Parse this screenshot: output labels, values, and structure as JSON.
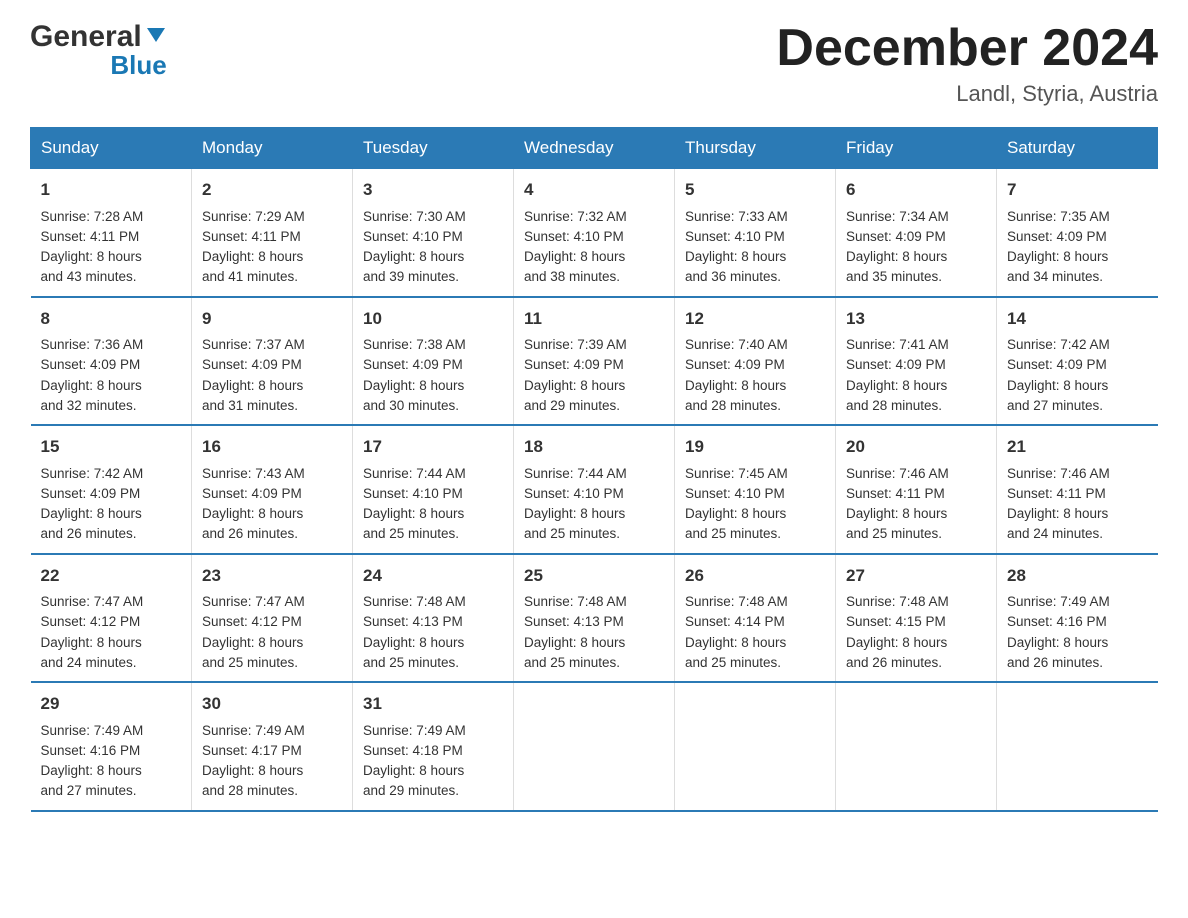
{
  "header": {
    "logo_general": "General",
    "logo_blue": "Blue",
    "month_title": "December 2024",
    "location": "Landl, Styria, Austria"
  },
  "days_of_week": [
    "Sunday",
    "Monday",
    "Tuesday",
    "Wednesday",
    "Thursday",
    "Friday",
    "Saturday"
  ],
  "weeks": [
    [
      {
        "day": "1",
        "sunrise": "7:28 AM",
        "sunset": "4:11 PM",
        "daylight": "8 hours and 43 minutes."
      },
      {
        "day": "2",
        "sunrise": "7:29 AM",
        "sunset": "4:11 PM",
        "daylight": "8 hours and 41 minutes."
      },
      {
        "day": "3",
        "sunrise": "7:30 AM",
        "sunset": "4:10 PM",
        "daylight": "8 hours and 39 minutes."
      },
      {
        "day": "4",
        "sunrise": "7:32 AM",
        "sunset": "4:10 PM",
        "daylight": "8 hours and 38 minutes."
      },
      {
        "day": "5",
        "sunrise": "7:33 AM",
        "sunset": "4:10 PM",
        "daylight": "8 hours and 36 minutes."
      },
      {
        "day": "6",
        "sunrise": "7:34 AM",
        "sunset": "4:09 PM",
        "daylight": "8 hours and 35 minutes."
      },
      {
        "day": "7",
        "sunrise": "7:35 AM",
        "sunset": "4:09 PM",
        "daylight": "8 hours and 34 minutes."
      }
    ],
    [
      {
        "day": "8",
        "sunrise": "7:36 AM",
        "sunset": "4:09 PM",
        "daylight": "8 hours and 32 minutes."
      },
      {
        "day": "9",
        "sunrise": "7:37 AM",
        "sunset": "4:09 PM",
        "daylight": "8 hours and 31 minutes."
      },
      {
        "day": "10",
        "sunrise": "7:38 AM",
        "sunset": "4:09 PM",
        "daylight": "8 hours and 30 minutes."
      },
      {
        "day": "11",
        "sunrise": "7:39 AM",
        "sunset": "4:09 PM",
        "daylight": "8 hours and 29 minutes."
      },
      {
        "day": "12",
        "sunrise": "7:40 AM",
        "sunset": "4:09 PM",
        "daylight": "8 hours and 28 minutes."
      },
      {
        "day": "13",
        "sunrise": "7:41 AM",
        "sunset": "4:09 PM",
        "daylight": "8 hours and 28 minutes."
      },
      {
        "day": "14",
        "sunrise": "7:42 AM",
        "sunset": "4:09 PM",
        "daylight": "8 hours and 27 minutes."
      }
    ],
    [
      {
        "day": "15",
        "sunrise": "7:42 AM",
        "sunset": "4:09 PM",
        "daylight": "8 hours and 26 minutes."
      },
      {
        "day": "16",
        "sunrise": "7:43 AM",
        "sunset": "4:09 PM",
        "daylight": "8 hours and 26 minutes."
      },
      {
        "day": "17",
        "sunrise": "7:44 AM",
        "sunset": "4:10 PM",
        "daylight": "8 hours and 25 minutes."
      },
      {
        "day": "18",
        "sunrise": "7:44 AM",
        "sunset": "4:10 PM",
        "daylight": "8 hours and 25 minutes."
      },
      {
        "day": "19",
        "sunrise": "7:45 AM",
        "sunset": "4:10 PM",
        "daylight": "8 hours and 25 minutes."
      },
      {
        "day": "20",
        "sunrise": "7:46 AM",
        "sunset": "4:11 PM",
        "daylight": "8 hours and 25 minutes."
      },
      {
        "day": "21",
        "sunrise": "7:46 AM",
        "sunset": "4:11 PM",
        "daylight": "8 hours and 24 minutes."
      }
    ],
    [
      {
        "day": "22",
        "sunrise": "7:47 AM",
        "sunset": "4:12 PM",
        "daylight": "8 hours and 24 minutes."
      },
      {
        "day": "23",
        "sunrise": "7:47 AM",
        "sunset": "4:12 PM",
        "daylight": "8 hours and 25 minutes."
      },
      {
        "day": "24",
        "sunrise": "7:48 AM",
        "sunset": "4:13 PM",
        "daylight": "8 hours and 25 minutes."
      },
      {
        "day": "25",
        "sunrise": "7:48 AM",
        "sunset": "4:13 PM",
        "daylight": "8 hours and 25 minutes."
      },
      {
        "day": "26",
        "sunrise": "7:48 AM",
        "sunset": "4:14 PM",
        "daylight": "8 hours and 25 minutes."
      },
      {
        "day": "27",
        "sunrise": "7:48 AM",
        "sunset": "4:15 PM",
        "daylight": "8 hours and 26 minutes."
      },
      {
        "day": "28",
        "sunrise": "7:49 AM",
        "sunset": "4:16 PM",
        "daylight": "8 hours and 26 minutes."
      }
    ],
    [
      {
        "day": "29",
        "sunrise": "7:49 AM",
        "sunset": "4:16 PM",
        "daylight": "8 hours and 27 minutes."
      },
      {
        "day": "30",
        "sunrise": "7:49 AM",
        "sunset": "4:17 PM",
        "daylight": "8 hours and 28 minutes."
      },
      {
        "day": "31",
        "sunrise": "7:49 AM",
        "sunset": "4:18 PM",
        "daylight": "8 hours and 29 minutes."
      },
      null,
      null,
      null,
      null
    ]
  ]
}
